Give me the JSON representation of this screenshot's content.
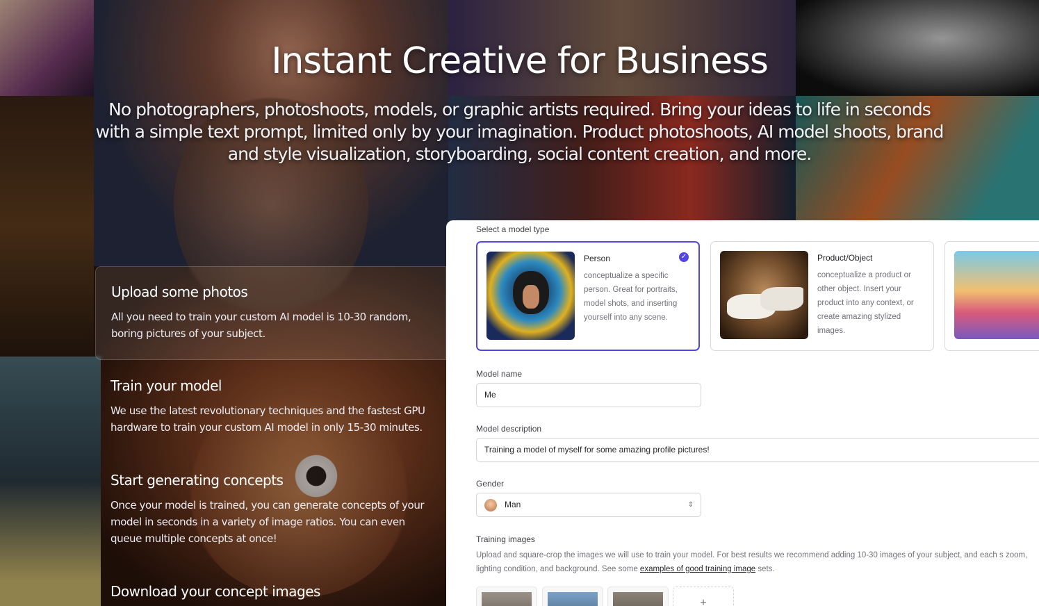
{
  "hero": {
    "title": "Instant Creative for Business",
    "subtitle": "No photographers, photoshoots, models, or graphic artists required. Bring your ideas to life in seconds with a simple text prompt, limited only by your imagination. Product photoshoots, AI model shoots, brand and style visualization, storyboarding, social content creation, and more."
  },
  "steps": [
    {
      "title": "Upload some photos",
      "text": "All you need to train your custom AI model is 10-30 random, boring pictures of your subject."
    },
    {
      "title": "Train your model",
      "text": "We use the latest revolutionary techniques and the fastest GPU hardware to train your custom AI model in only 15-30 minutes."
    },
    {
      "title": "Start generating concepts",
      "text": "Once your model is trained, you can generate concepts of your model in seconds in a variety of image ratios. You can even queue multiple concepts at once!"
    },
    {
      "title": "Download your concept images",
      "text": ""
    }
  ],
  "form": {
    "model_type_label": "Select a model type",
    "cards": [
      {
        "title": "Person",
        "desc": "conceptualize a specific person. Great for portraits, model shots, and inserting yourself into any scene.",
        "selected": true
      },
      {
        "title": "Product/Object",
        "desc": "conceptualize a product or other object. Insert your product into any context, or create amazing stylized images.",
        "selected": false
      },
      {
        "title": "",
        "desc": "",
        "selected": false
      }
    ],
    "model_name_label": "Model name",
    "model_name_value": "Me",
    "model_desc_label": "Model description",
    "model_desc_value": "Training a model of myself for some amazing profile pictures!",
    "gender_label": "Gender",
    "gender_value": "Man",
    "training_label": "Training images",
    "training_help_pre": "Upload and square-crop the images we will use to train your model. For best results we recommend adding 10-30 images of your subject, and each s zoom, lighting condition, and background. See some ",
    "training_help_link": "examples of good training image",
    "training_help_post": " sets.",
    "add_label": "+"
  },
  "colors": {
    "accent": "#4f46e5",
    "panel_bg": "#ffffff"
  }
}
